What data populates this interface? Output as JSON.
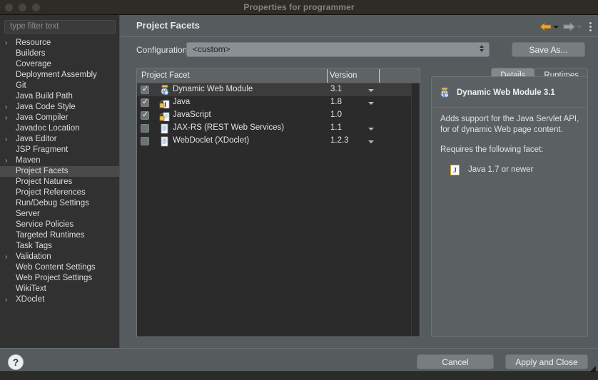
{
  "window": {
    "title": "Properties for programmer",
    "controls": [
      "close",
      "minimize",
      "zoom"
    ]
  },
  "sidebar": {
    "filter": {
      "placeholder": "type filter text",
      "value": ""
    },
    "items": [
      {
        "label": "Resource",
        "expandable": true,
        "selected": false
      },
      {
        "label": "Builders",
        "expandable": false,
        "selected": false
      },
      {
        "label": "Coverage",
        "expandable": false,
        "selected": false
      },
      {
        "label": "Deployment Assembly",
        "expandable": false,
        "selected": false
      },
      {
        "label": "Git",
        "expandable": false,
        "selected": false
      },
      {
        "label": "Java Build Path",
        "expandable": false,
        "selected": false
      },
      {
        "label": "Java Code Style",
        "expandable": true,
        "selected": false
      },
      {
        "label": "Java Compiler",
        "expandable": true,
        "selected": false
      },
      {
        "label": "Javadoc Location",
        "expandable": false,
        "selected": false
      },
      {
        "label": "Java Editor",
        "expandable": true,
        "selected": false
      },
      {
        "label": "JSP Fragment",
        "expandable": false,
        "selected": false
      },
      {
        "label": "Maven",
        "expandable": true,
        "selected": false
      },
      {
        "label": "Project Facets",
        "expandable": false,
        "selected": true
      },
      {
        "label": "Project Natures",
        "expandable": false,
        "selected": false
      },
      {
        "label": "Project References",
        "expandable": false,
        "selected": false
      },
      {
        "label": "Run/Debug Settings",
        "expandable": false,
        "selected": false
      },
      {
        "label": "Server",
        "expandable": false,
        "selected": false
      },
      {
        "label": "Service Policies",
        "expandable": false,
        "selected": false
      },
      {
        "label": "Targeted Runtimes",
        "expandable": false,
        "selected": false
      },
      {
        "label": "Task Tags",
        "expandable": false,
        "selected": false
      },
      {
        "label": "Validation",
        "expandable": true,
        "selected": false
      },
      {
        "label": "Web Content Settings",
        "expandable": false,
        "selected": false
      },
      {
        "label": "Web Project Settings",
        "expandable": false,
        "selected": false
      },
      {
        "label": "WikiText",
        "expandable": false,
        "selected": false
      },
      {
        "label": "XDoclet",
        "expandable": true,
        "selected": false
      }
    ],
    "twisty_glyph": "›"
  },
  "page": {
    "title": "Project Facets",
    "toolbar": {
      "back_label": "Back",
      "forward_label": "Forward",
      "menu_label": "View Menu"
    }
  },
  "configuration": {
    "label": "Configuration:",
    "value": "<custom>",
    "save_as_label": "Save As..."
  },
  "facet_table": {
    "columns": [
      "Project Facet",
      "Version"
    ],
    "rows": [
      {
        "checked": true,
        "name": "Dynamic Web Module",
        "version": "3.1",
        "has_version_menu": true,
        "icon": "dynamic-web-module-icon",
        "locked": true,
        "selected": true
      },
      {
        "checked": true,
        "name": "Java",
        "version": "1.8",
        "has_version_menu": true,
        "icon": "java-facet-icon",
        "locked": true,
        "selected": false
      },
      {
        "checked": true,
        "name": "JavaScript",
        "version": "1.0",
        "has_version_menu": false,
        "icon": "javascript-facet-icon",
        "locked": true,
        "selected": false
      },
      {
        "checked": false,
        "name": "JAX-RS (REST Web Services)",
        "version": "1.1",
        "has_version_menu": true,
        "icon": "document-icon",
        "locked": false,
        "selected": false
      },
      {
        "checked": false,
        "name": "WebDoclet (XDoclet)",
        "version": "1.2.3",
        "has_version_menu": true,
        "icon": "document-icon",
        "locked": false,
        "selected": false
      }
    ]
  },
  "details": {
    "tabs": [
      {
        "label": "Details",
        "active": true
      },
      {
        "label": "Runtimes",
        "active": false
      }
    ],
    "heading": "Dynamic Web Module 3.1",
    "description_line_1": "Adds support for the Java Servlet API, for",
    "description_line_2": "of dynamic Web page content.",
    "requires_label": "Requires the following facet:",
    "requirement": "Java 1.7 or newer"
  },
  "footer": {
    "help_label": "?",
    "cancel_label": "Cancel",
    "apply_label": "Apply and Close"
  },
  "colors": {
    "accent_orange": "#e8a33d",
    "window_chrome": "#2f2c28",
    "panel_bg": "#565b5e",
    "sidebar_bg": "#313131",
    "table_bg": "#2b2b2b",
    "selection": "#4a4a4a"
  }
}
